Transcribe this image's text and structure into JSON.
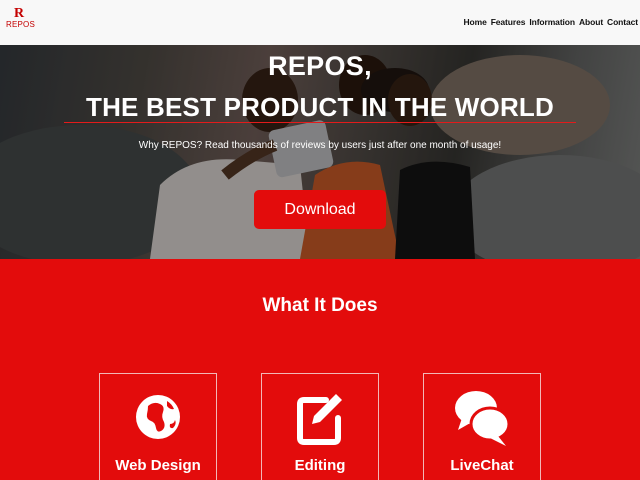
{
  "brand": {
    "mark": "R",
    "name": "REPOS"
  },
  "nav": {
    "links": [
      "Home",
      "Features",
      "Information",
      "About",
      "Contact"
    ]
  },
  "hero": {
    "title_line1": "REPOS,",
    "title_line2": "THE BEST PRODUCT IN THE WORLD",
    "subtitle": "Why REPOS? Read thousands of reviews by users just after one month of usage!",
    "download_label": "Download"
  },
  "features": {
    "title": "What It Does",
    "cards": [
      {
        "label": "Web Design",
        "icon": "globe-icon"
      },
      {
        "label": "Editing",
        "icon": "edit-icon"
      },
      {
        "label": "LiveChat",
        "icon": "chat-icon"
      }
    ]
  },
  "colors": {
    "accent": "#e30c0c",
    "brand": "#c40000",
    "navbar_bg": "#f8f8f8"
  }
}
